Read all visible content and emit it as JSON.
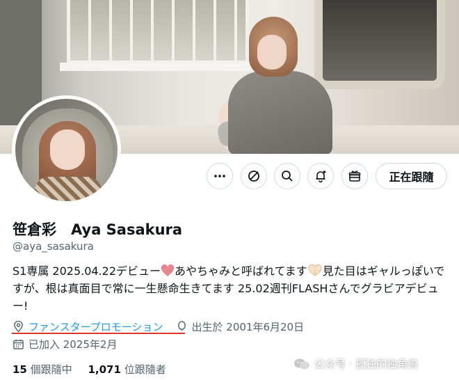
{
  "profile": {
    "display_name": "笹倉彩　Aya Sasakura",
    "handle": "@aya_sasakura",
    "bio": {
      "part1": "S1専属 2025.04.22デビュー",
      "part2": "あやちゃみと呼ばれてます",
      "part3": "見た目はギャルっぽいですが、根は真面目で常に一生懸命生きてます 25.02週刊FLASHさんでグラビアデビュー!"
    },
    "location": "ファンスタープロモーション",
    "birthdate": "出生於 2001年6月20日",
    "joined": "已加入 2025年2月"
  },
  "actions": {
    "follow_label": "正在跟隨"
  },
  "stats": {
    "following_count": "15",
    "following_label": "個跟隨中",
    "followers_count": "1,071",
    "followers_label": "位跟隨者"
  },
  "watermark": {
    "text": "公众号 · 孤独的独角兽"
  },
  "icons": [
    "more-icon",
    "grok-icon",
    "search-icon",
    "notification-bell-icon",
    "subscribe-gift-icon",
    "location-pin-icon",
    "birthday-balloon-icon",
    "calendar-icon",
    "heart-emoji-icon",
    "heart-hands-emoji-icon",
    "wechat-icon"
  ],
  "colors": {
    "accent": "#1d9bf0",
    "text_secondary": "#536471",
    "underline": "#e0352b",
    "heart": "#e8868f"
  }
}
